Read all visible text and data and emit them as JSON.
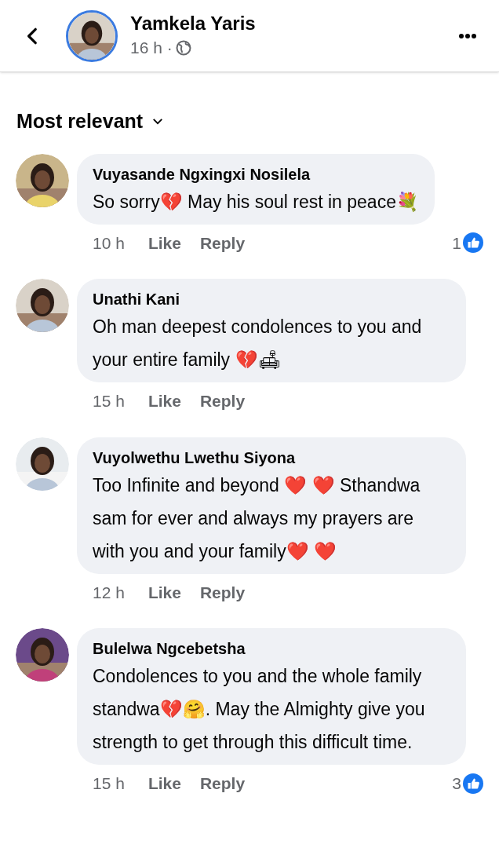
{
  "header": {
    "author": "Yamkela Yaris",
    "time": "16 h ·"
  },
  "sort": {
    "label": "Most relevant"
  },
  "comments": [
    {
      "name": "Vuyasande Ngxingxi Nosilela",
      "text": "So sorry💔 May his soul rest in peace💐",
      "time": "10 h",
      "like": "Like",
      "reply": "Reply",
      "reactions": "1"
    },
    {
      "name": "Unathi Kani",
      "text": "Oh man deepest condolences to you and your entire family 💔🛋",
      "time": "15 h",
      "like": "Like",
      "reply": "Reply"
    },
    {
      "name": "Vuyolwethu Lwethu Siyona",
      "text": "Too Infinite and beyond ❤️ ❤️ Sthandwa sam for ever and always my prayers are with you and your family❤️ ❤️",
      "time": "12 h",
      "like": "Like",
      "reply": "Reply"
    },
    {
      "name": "Bulelwa Ngcebetsha",
      "text": "Condolences to you and the whole family standwa💔🤗.  May the Almighty give you strength to get through this difficult time.",
      "time": "15 h",
      "like": "Like",
      "reply": "Reply",
      "reactions": "3"
    }
  ]
}
